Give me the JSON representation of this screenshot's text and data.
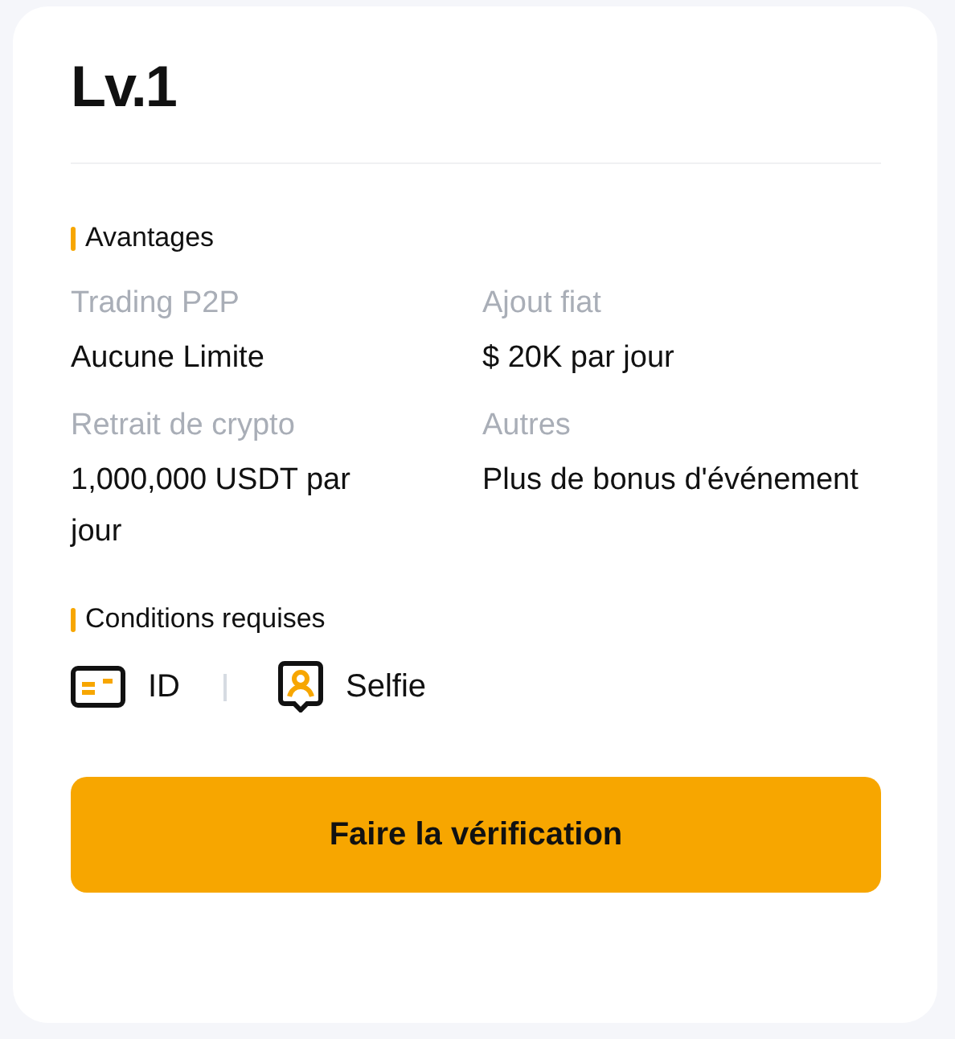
{
  "level_title": "Lv.1",
  "benefits": {
    "heading": "Avantages",
    "items": [
      {
        "label": "Trading P2P",
        "value": "Aucune Limite"
      },
      {
        "label": "Ajout fiat",
        "value": "$ 20K par jour"
      },
      {
        "label": "Retrait de crypto",
        "value": "1,000,000 USDT par jour"
      },
      {
        "label": "Autres",
        "value": "Plus de bonus d'événement"
      }
    ]
  },
  "requirements": {
    "heading": "Conditions requises",
    "items": [
      {
        "kind": "id",
        "label": "ID"
      },
      {
        "kind": "selfie",
        "label": "Selfie"
      }
    ]
  },
  "button": "Faire la vérification"
}
